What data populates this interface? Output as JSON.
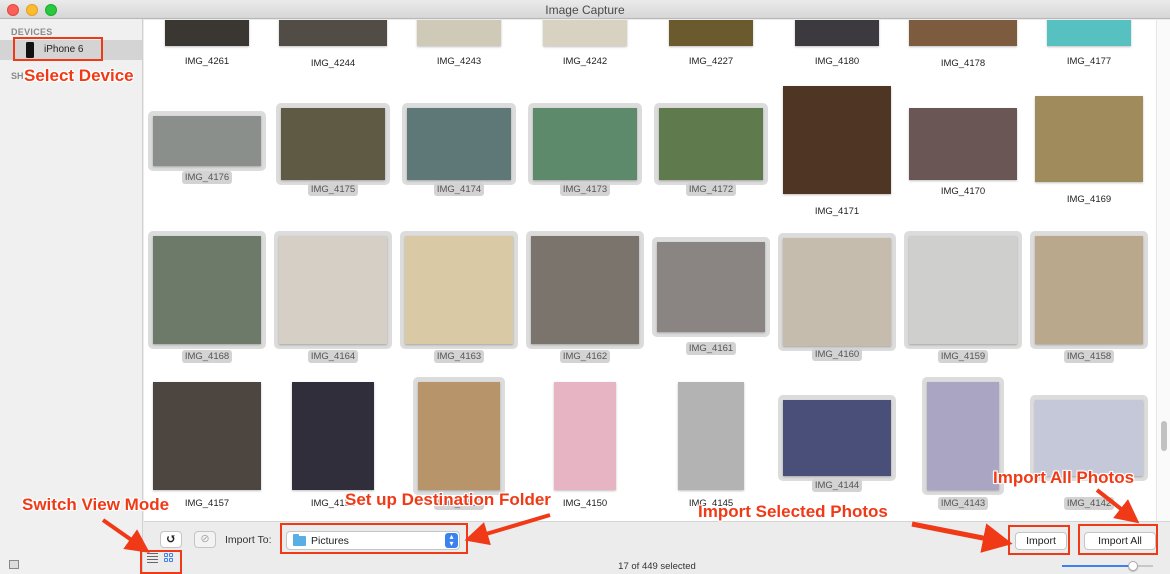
{
  "window": {
    "title": "Image Capture"
  },
  "sidebar": {
    "devices_header": "DEVICES",
    "shared_header": "SH",
    "device": {
      "name": "iPhone 6",
      "icon": "iphone-icon"
    }
  },
  "grid": {
    "rows": [
      [
        {
          "name": "IMG_4261",
          "selected": false,
          "color": "#3a3632"
        },
        {
          "name": "IMG_4244",
          "selected": false,
          "color": "#514c45"
        },
        {
          "name": "IMG_4243",
          "selected": false,
          "color": "#cfc9b8"
        },
        {
          "name": "IMG_4242",
          "selected": false,
          "color": "#d8d2c2"
        },
        {
          "name": "IMG_4227",
          "selected": false,
          "color": "#6b5a2e"
        },
        {
          "name": "IMG_4180",
          "selected": false,
          "color": "#3c3a3e"
        },
        {
          "name": "IMG_4178",
          "selected": false,
          "color": "#7d5b3e"
        },
        {
          "name": "IMG_4177",
          "selected": false,
          "color": "#56c1c0"
        }
      ],
      [
        {
          "name": "IMG_4176",
          "selected": true,
          "color": "#8b8f8c"
        },
        {
          "name": "IMG_4175",
          "selected": true,
          "color": "#5e5a44"
        },
        {
          "name": "IMG_4174",
          "selected": true,
          "color": "#5e7777"
        },
        {
          "name": "IMG_4173",
          "selected": true,
          "color": "#5d8a6a"
        },
        {
          "name": "IMG_4172",
          "selected": true,
          "color": "#5f7b4d"
        },
        {
          "name": "IMG_4171",
          "selected": false,
          "color": "#4e3524"
        },
        {
          "name": "IMG_4170",
          "selected": false,
          "color": "#6a5654"
        },
        {
          "name": "IMG_4169",
          "selected": false,
          "color": "#a08b5c"
        }
      ],
      [
        {
          "name": "IMG_4168",
          "selected": true,
          "color": "#6d7a6a"
        },
        {
          "name": "IMG_4164",
          "selected": true,
          "color": "#d5cfc6"
        },
        {
          "name": "IMG_4163",
          "selected": true,
          "color": "#d9c9a4"
        },
        {
          "name": "IMG_4162",
          "selected": true,
          "color": "#7a746d"
        },
        {
          "name": "IMG_4161",
          "selected": true,
          "color": "#8a8582"
        },
        {
          "name": "IMG_4160",
          "selected": true,
          "color": "#c6bcad"
        },
        {
          "name": "IMG_4159",
          "selected": true,
          "color": "#cfcfcd"
        },
        {
          "name": "IMG_4158",
          "selected": true,
          "color": "#b9a88c"
        }
      ],
      [
        {
          "name": "IMG_4157",
          "selected": false,
          "color": "#4d4540"
        },
        {
          "name": "IMG_4151",
          "selected": false,
          "color": "#2f2e3a"
        },
        {
          "name": "IMG_4153",
          "selected": true,
          "color": "#b8946a"
        },
        {
          "name": "IMG_4150",
          "selected": false,
          "color": "#e7b4c4"
        },
        {
          "name": "IMG_4145",
          "selected": false,
          "color": "#b3b3b3"
        },
        {
          "name": "IMG_4144",
          "selected": true,
          "color": "#4a4f7a"
        },
        {
          "name": "IMG_4143",
          "selected": true,
          "color": "#a9a5c2"
        },
        {
          "name": "IMG_4142",
          "selected": true,
          "color": "#c5c8d9"
        }
      ]
    ]
  },
  "toolbar": {
    "rotate_icon": "↺",
    "delete_icon": "⊘",
    "import_to_label": "Import To:",
    "destination": "Pictures",
    "import_label": "Import",
    "import_all_label": "Import All",
    "status": "17 of 449 selected",
    "thumbnail_size_percent": 78
  },
  "annotations": {
    "select_device": "Select Device",
    "switch_view": "Switch View Mode",
    "destination": "Set up Destination Folder",
    "import_selected": "Import Selected Photos",
    "import_all": "Import All Photos",
    "color": "#f03a17"
  }
}
